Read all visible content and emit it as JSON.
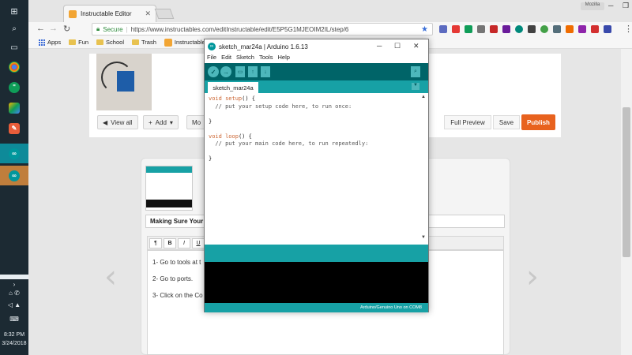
{
  "taskbar": {
    "time": "8:32 PM",
    "date": "3/24/2018"
  },
  "chrome": {
    "tab_title": "Instructable Editor",
    "profile_label": "Mozilla",
    "secure_label": "Secure",
    "url": "https://www.instructables.com/editInstructable/edit/E5P5G1MJEOIM2IL/step/6",
    "bookmarks": [
      "Apps",
      "Fun",
      "School",
      "Trash",
      "Instructable Edi"
    ]
  },
  "editor": {
    "view_all": "View all",
    "add": "Add",
    "more": "Mo",
    "full_preview": "Full Preview",
    "save": "Save",
    "publish": "Publish",
    "step_title": "Making Sure Your",
    "rte_buttons": [
      "¶",
      "B",
      "I",
      "U"
    ],
    "body_lines": [
      "1- Go to tools at t",
      "2- Go to ports.",
      "3- Click on the Co"
    ]
  },
  "arduino": {
    "title": "sketch_mar24a | Arduino 1.6.13",
    "menu": [
      "File",
      "Edit",
      "Sketch",
      "Tools",
      "Help"
    ],
    "tab": "sketch_mar24a",
    "code": {
      "l1_kw1": "void",
      "l1_kw2": "setup",
      "l1_rest": "() {",
      "l2": "  // put your setup code here, to run once:",
      "l3": "}",
      "l4_kw1": "void",
      "l4_kw2": "loop",
      "l4_rest": "() {",
      "l5": "  // put your main code here, to run repeatedly:",
      "l6": "}"
    },
    "footer": "Arduino/Genuino Uno on COM8"
  }
}
